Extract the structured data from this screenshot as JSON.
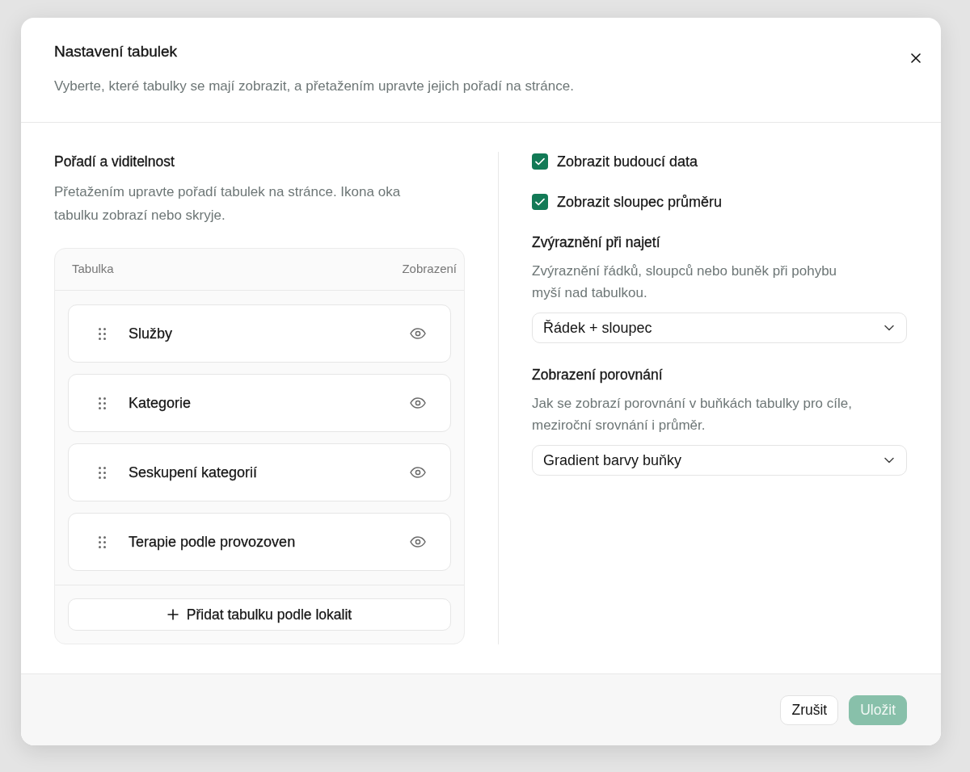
{
  "dialog": {
    "title": "Nastavení tabulek",
    "subtitle": "Vyberte, které tabulky se mají zobrazit, a přetažením upravte jejich pořadí na stránce."
  },
  "order_section": {
    "title": "Pořadí a viditelnost",
    "description": "Přetažením upravte pořadí tabulek na stránce. Ikona oka tabulku zobrazí nebo skryje.",
    "table": {
      "columns": [
        "Tabulka",
        "Zobrazení"
      ],
      "rows": [
        {
          "name": "Služby",
          "visible": true
        },
        {
          "name": "Kategorie",
          "visible": true
        },
        {
          "name": "Seskupení kategorií",
          "visible": true
        },
        {
          "name": "Terapie podle provozoven",
          "visible": true
        }
      ],
      "add_button": "Přidat tabulku podle lokalit"
    }
  },
  "options": [
    {
      "kind": "checkbox",
      "label": "Zobrazit budoucí data",
      "checked": true
    },
    {
      "kind": "checkbox",
      "label": "Zobrazit sloupec průměru",
      "checked": true
    },
    {
      "kind": "select",
      "label": "Zvýraznění při najetí",
      "description": "Zvýraznění řádků, sloupců nebo buněk při pohybu myší nad tabulkou.",
      "value": "Řádek + sloupec"
    },
    {
      "kind": "select",
      "label": "Zobrazení porovnání",
      "description": "Jak se zobrazí porovnání v buňkách tabulky pro cíle, meziroční srovnání i průměr.",
      "value": "Gradient barvy buňky"
    }
  ],
  "footer": {
    "buttons": [
      {
        "kind": "secondary",
        "label": "Zrušit",
        "disabled": false
      },
      {
        "kind": "primary",
        "label": "Uložit",
        "disabled": true
      }
    ]
  }
}
